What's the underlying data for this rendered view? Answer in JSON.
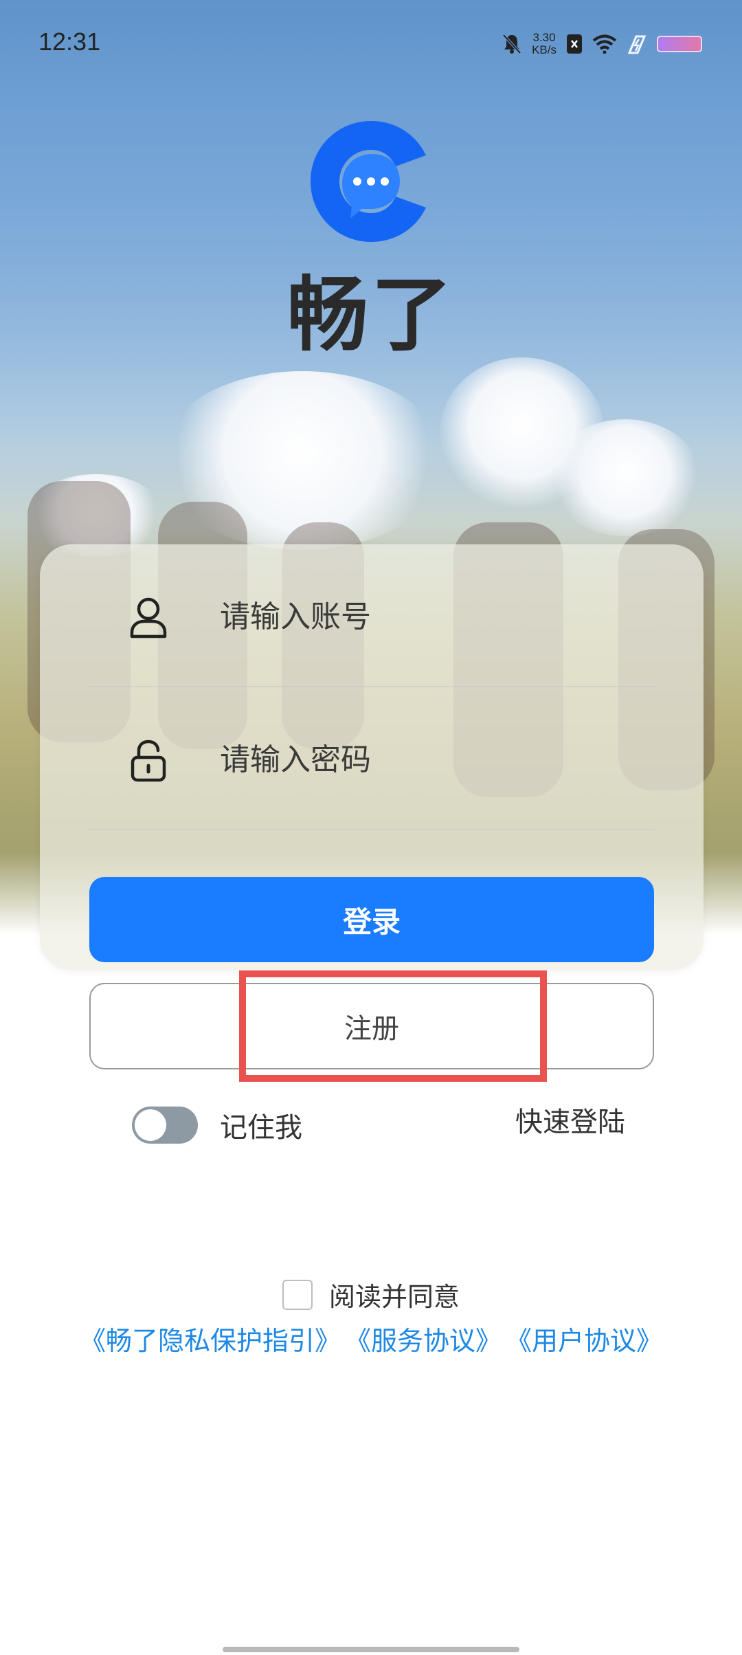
{
  "status_bar": {
    "time": "12:31",
    "net_speed_value": "3.30",
    "net_speed_unit": "KB/s",
    "icons": [
      "mute-bell-icon",
      "sim-icon",
      "wifi-icon",
      "charging-icon",
      "battery-icon"
    ]
  },
  "app": {
    "name": "畅了",
    "logo_icon": "chat-bubble-c-logo",
    "brand_color": "#1565f5"
  },
  "login_form": {
    "account_placeholder": "请输入账号",
    "password_placeholder": "请输入密码",
    "account_icon": "user-icon",
    "password_icon": "lock-icon",
    "login_label": "登录",
    "register_label": "注册",
    "primary_color": "#1a7cff"
  },
  "options": {
    "remember_label": "记住我",
    "remember_enabled": false,
    "quick_login_label": "快速登陆"
  },
  "agreement": {
    "checked": false,
    "text": "阅读并同意",
    "privacy_link": "《畅了隐私保护指引》",
    "service_link": "《服务协议》",
    "user_link": "《用户协议》",
    "link_color": "#1e88e5"
  },
  "annotation": {
    "highlight_color": "#e8534f"
  }
}
